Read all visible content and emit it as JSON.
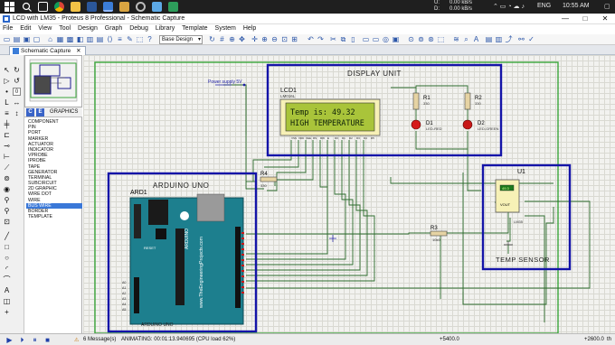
{
  "taskbar": {
    "icons": [
      "windows",
      "search",
      "task-view",
      "chrome",
      "file-explorer",
      "word",
      "proteus",
      "folder",
      "settings",
      "paint",
      "app"
    ],
    "net_up": "0.00 kB/s",
    "net_down": "0.00 kB/s",
    "net_up_label": "U:",
    "net_down_label": "D:",
    "language": "ENG",
    "time": "10:55 AM"
  },
  "window": {
    "title": "LCD with LM35 - Proteus 8 Professional - Schematic Capture",
    "minimize": "—",
    "maximize": "□",
    "close": "✕"
  },
  "menu": [
    "File",
    "Edit",
    "View",
    "Tool",
    "Design",
    "Graph",
    "Debug",
    "Library",
    "Template",
    "System",
    "Help"
  ],
  "toolbar": {
    "layer_select": "Base Design"
  },
  "tabs": {
    "active": "Schematic Capture"
  },
  "device_panel": {
    "buttons": [
      "C",
      "E"
    ],
    "header": "GRAPHICS",
    "items": [
      "COMPONENT",
      "PIN",
      "PORT",
      "MARKER",
      "ACTUATOR",
      "INDICATOR",
      "VPROBE",
      "IPROBE",
      "TAPE",
      "GENERATOR",
      "TERMINAL",
      "SUBCIRCUIT",
      "2D GRAPHIC",
      "WIRE DOT",
      "WIRE",
      "BUS WIRE",
      "BORDER",
      "TEMPLATE"
    ],
    "selected": "BUS WIRE"
  },
  "schematic": {
    "display_unit_label": "DISPLAY UNIT",
    "arduino_label": "ARDUINO UNO",
    "temp_sensor_label": "TEMP SENSOR",
    "lcd_ref": "LCD1",
    "lcd_part": "LM016L",
    "lcd_line1": "Temp is: 49.32",
    "lcd_line2": "HIGH TEMPERATURE",
    "power_label": "Power supply 5V",
    "r1_ref": "R1",
    "r1_val": "330",
    "r2_ref": "R2",
    "r2_val": "330",
    "d1_ref": "D1",
    "d1_part": "LED-RED",
    "d2_ref": "D2",
    "d2_part": "LED-GREEN",
    "r4_ref": "R4",
    "r4_val": "330",
    "r3_ref": "R3",
    "r3_val": "10k0",
    "u1_ref": "U1",
    "u1_part": "LM35",
    "u1_pin": "VOUT",
    "u1_display": "49.3",
    "ard_ref": "ARD1",
    "ard_footer": "ARDUINO UNO",
    "ard_site": "www.TheEngineeringProjects.com",
    "ard_brand": "ARDUINO",
    "ard_reset": "RESET",
    "ard_analog": [
      "A0",
      "A1",
      "A2",
      "A3",
      "A4",
      "A5"
    ]
  },
  "status": {
    "messages": "6 Message(s)",
    "animating": "ANIMATING: 00:01:13.940695 (CPU load 62%)",
    "coord_x": "+5400.0",
    "coord_y": "+2600.0",
    "coord_unit": "th"
  }
}
